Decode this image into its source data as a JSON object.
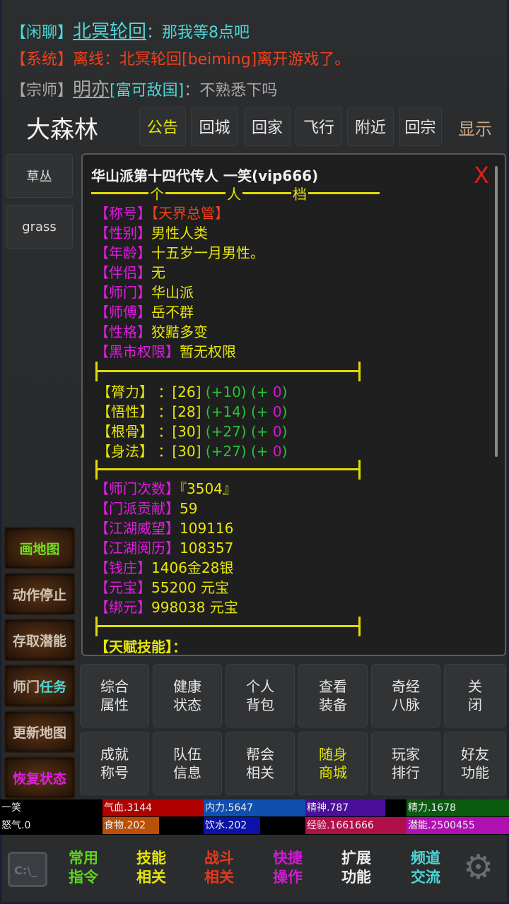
{
  "chat": [
    {
      "channel": "【闲聊】",
      "name": "北冥轮回",
      "tag": "",
      "message": "：那我等8点吧",
      "color": "#4fd6d6"
    },
    {
      "channel": "【系统】",
      "name": "",
      "tag": "",
      "message": "离线：北冥轮回[beiming]离开游戏了。",
      "color": "#f0421c"
    },
    {
      "channel": "【宗师】",
      "name": "明亦",
      "tag": "[富可敌国]",
      "message": "：不熟悉下吗",
      "color": "#a8a8a8"
    }
  ],
  "location": "大森林",
  "top_buttons": [
    "公告",
    "回城",
    "回家",
    "飞行",
    "附近",
    "回宗"
  ],
  "display_label": "显示",
  "left_items": [
    "草丛",
    "grass"
  ],
  "side_buttons": [
    "画地图",
    "动作停止",
    "存取潜能",
    "师门任务",
    "更新地图",
    "恢复状态"
  ],
  "panel": {
    "title": "华山派第十四代传人 一笑(vip666)",
    "header_chars": [
      "个",
      "人",
      "档"
    ],
    "close": "X",
    "info": [
      {
        "k": "【称号】",
        "v": "【天界总管】"
      },
      {
        "k": "【性别】",
        "v": "男性人类"
      },
      {
        "k": "【年龄】",
        "v": "十五岁一月男性。"
      },
      {
        "k": "【伴侣】",
        "v": "无"
      },
      {
        "k": "【师门】",
        "v": "华山派"
      },
      {
        "k": "【师傅】",
        "v": "岳不群"
      },
      {
        "k": "【性格】",
        "v": "狡黠多变"
      },
      {
        "k": "【黑市权限】",
        "v": "暂无权限"
      }
    ],
    "attrs": [
      {
        "k": "【膂力】",
        "base": "：[26]",
        "bonus": "(+10)",
        "extra": "0"
      },
      {
        "k": "【悟性】",
        "base": "：[28]",
        "bonus": "(+14)",
        "extra": "0"
      },
      {
        "k": "【根骨】",
        "base": "：[30]",
        "bonus": "(+27)",
        "extra": "0"
      },
      {
        "k": "【身法】",
        "base": "：[30]",
        "bonus": "(+27)",
        "extra": "0"
      }
    ],
    "stats": [
      {
        "k": "【师门次数】",
        "v": "『3504』"
      },
      {
        "k": "【门派贡献】",
        "v": "59"
      },
      {
        "k": "【江湖威望】",
        "v": "109116"
      },
      {
        "k": "【江湖阅历】",
        "v": "108357"
      },
      {
        "k": "【钱庄】",
        "v": "1406金28银"
      },
      {
        "k": "【元宝】",
        "v": "55200 元宝"
      },
      {
        "k": "【绑元】",
        "v": "998038 元宝"
      }
    ],
    "talent": "【天赋技能】："
  },
  "grid": [
    [
      "综合\n属性",
      "健康\n状态",
      "个人\n背包",
      "查看\n装备",
      "奇经\n八脉",
      "关\n闭"
    ],
    [
      "成就\n称号",
      "队伍\n信息",
      "帮会\n相关",
      "随身\n商城",
      "玩家\n排行",
      "好友\n功能"
    ]
  ],
  "status": {
    "name": "一笑",
    "hp": "气血.3144",
    "mp": "内力.5647",
    "spirit": "精神.787",
    "energy": "精力.1678",
    "rage": "怒气.0",
    "food": "食物.202",
    "water": "饮水.202",
    "exp": "经验.1661666",
    "potential": "潜能.2500455"
  },
  "nav": [
    {
      "label": "常用\n指令",
      "color": "#5ed41c"
    },
    {
      "label": "技能\n相关",
      "color": "#e6e60a"
    },
    {
      "label": "战斗\n相关",
      "color": "#e8381c"
    },
    {
      "label": "快捷\n操作",
      "color": "#d21ad2"
    },
    {
      "label": "扩展\n功能",
      "color": "#eeeeee"
    },
    {
      "label": "频道\n交流",
      "color": "#4fd6d6"
    }
  ],
  "console_icon_text": "C:\\_"
}
